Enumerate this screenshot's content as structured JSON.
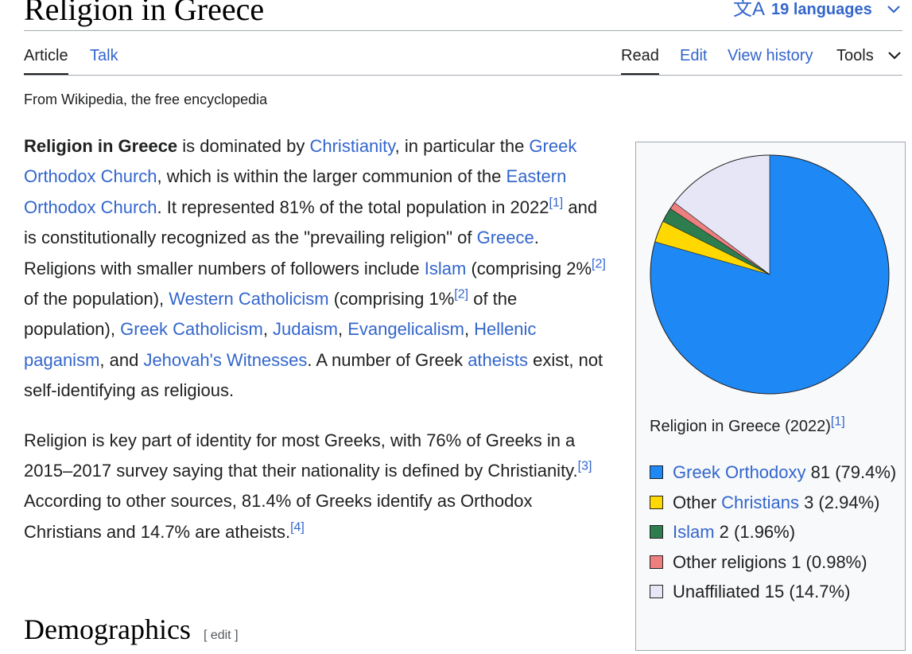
{
  "header": {
    "title": "Religion in Greece",
    "languages_label": "19 languages",
    "languages_icon": "translate-icon"
  },
  "tabs": {
    "article": "Article",
    "talk": "Talk",
    "read": "Read",
    "edit": "Edit",
    "view_history": "View history",
    "tools": "Tools"
  },
  "tagline": "From Wikipedia, the free encyclopedia",
  "paragraph1": {
    "bold_subject": "Religion in Greece",
    "t1": " is dominated by ",
    "link_christianity": "Christianity",
    "t2": ", in particular the ",
    "link_greek_orthodox_church": "Greek Orthodox Church",
    "t3": ", which is within the larger communion of the ",
    "link_eastern_orthodox_church": "Eastern Orthodox Church",
    "t4": ". It represented 81% of the total population in 2022",
    "ref1": "[1]",
    "t5": " and is constitutionally recognized as the \"prevailing religion\" of ",
    "link_greece": "Greece",
    "t6": ". Religions with smaller numbers of followers include ",
    "link_islam": "Islam",
    "t7": " (comprising 2%",
    "ref2a": "[2]",
    "t8": " of the population), ",
    "link_western_catholicism": "Western Catholicism",
    "t9": " (comprising 1%",
    "ref2b": "[2]",
    "t10": " of the population), ",
    "link_greek_catholicism": "Greek Catholicism",
    "t11": ", ",
    "link_judaism": "Judaism",
    "t12": ", ",
    "link_evangelicalism": "Evangelicalism",
    "t13": ", ",
    "link_hellenic_paganism": "Hellenic paganism",
    "t14": ", and ",
    "link_jehovahs_witnesses": "Jehovah's Witnesses",
    "t15": ". A number of Greek ",
    "link_atheists": "atheists",
    "t16": " exist, not self-identifying as religious."
  },
  "paragraph2": {
    "t1": "Religion is key part of identity for most Greeks, with 76% of Greeks in a 2015–2017 survey saying that their nationality is defined by Christianity.",
    "ref3": "[3]",
    "t2": " According to other sources, 81.4% of Greeks identify as Orthodox Christians and 14.7% are atheists.",
    "ref4": "[4]"
  },
  "section": {
    "title": "Demographics",
    "edit_label": "[ edit ]"
  },
  "infobox": {
    "caption": "Religion in Greece (2022)",
    "caption_ref": "[1]",
    "legend": [
      {
        "link": "Greek Orthodoxy",
        "text": " 81 (79.4%)",
        "color": "#1e88f4"
      },
      {
        "prefix": "Other ",
        "link": "Christians",
        "text": " 3 (2.94%)",
        "color": "#ffd800"
      },
      {
        "link": "Islam",
        "text": " 2 (1.96%)",
        "color": "#2e7d4f"
      },
      {
        "prefix": "Other religions",
        "text": " 1 (0.98%)",
        "color": "#ee7f7f"
      },
      {
        "prefix": "Unaffiliated",
        "text": " 15 (14.7%)",
        "color": "#e6e6f7"
      }
    ]
  },
  "chart_data": {
    "type": "pie",
    "title": "Religion in Greece (2022)",
    "categories": [
      "Greek Orthodoxy",
      "Other Christians",
      "Islam",
      "Other religions",
      "Unaffiliated"
    ],
    "values": [
      81,
      3,
      2,
      1,
      15
    ],
    "percent": [
      79.4,
      2.94,
      1.96,
      0.98,
      14.7
    ],
    "colors": [
      "#1e88f4",
      "#ffd800",
      "#2e7d4f",
      "#ee7f7f",
      "#e6e6f7"
    ],
    "start": "12 o'clock",
    "direction": "clockwise"
  }
}
